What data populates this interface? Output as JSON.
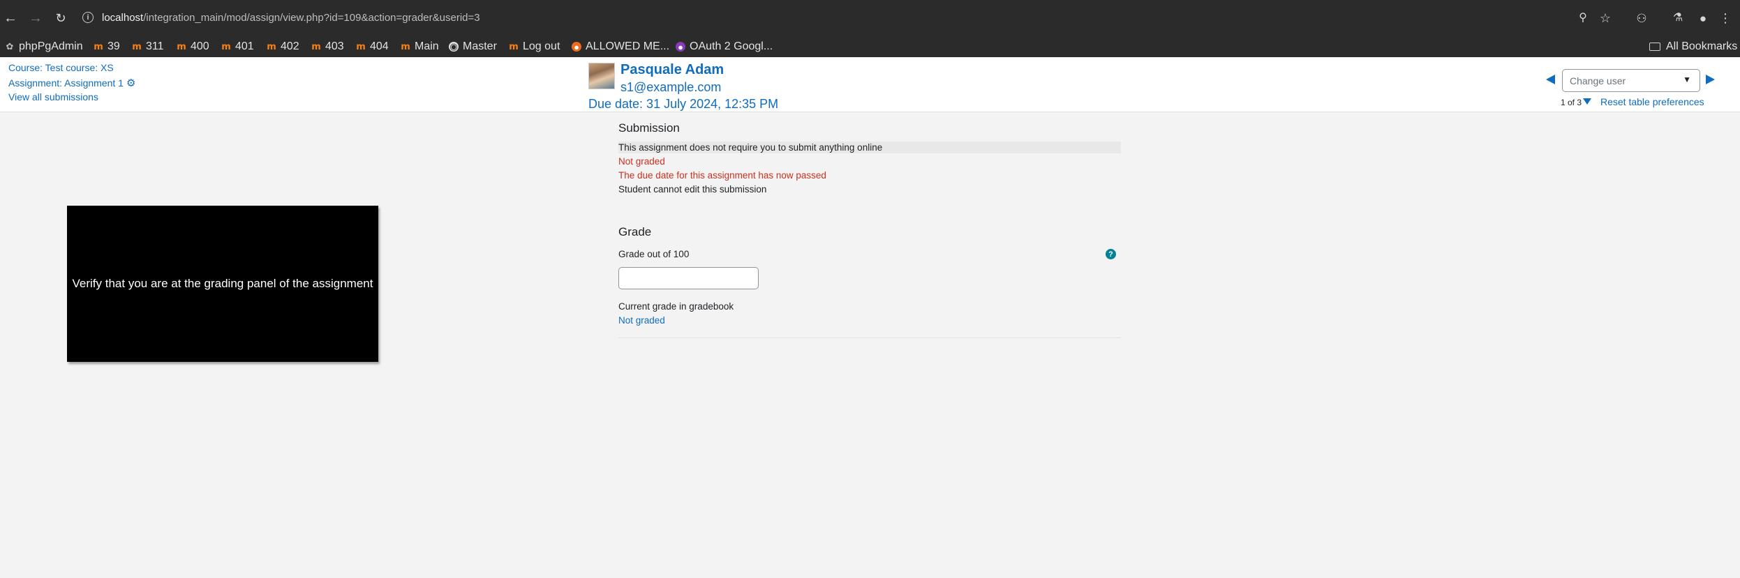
{
  "browser": {
    "url_host": "localhost",
    "url_path": "/integration_main/mod/assign/view.php?id=109&action=grader&userid=3",
    "bookmarks": [
      {
        "label": "phpPgAdmin",
        "icon": "elephant-icon"
      },
      {
        "label": "39",
        "icon": "moodle-icon"
      },
      {
        "label": "311",
        "icon": "moodle-icon"
      },
      {
        "label": "400",
        "icon": "moodle-icon"
      },
      {
        "label": "401",
        "icon": "moodle-icon"
      },
      {
        "label": "402",
        "icon": "moodle-icon"
      },
      {
        "label": "403",
        "icon": "moodle-icon"
      },
      {
        "label": "404",
        "icon": "moodle-icon"
      },
      {
        "label": "Main",
        "icon": "moodle-icon"
      },
      {
        "label": "Master",
        "icon": "globe-icon"
      },
      {
        "label": "Log out",
        "icon": "moodle-icon"
      },
      {
        "label": "ALLOWED ME...",
        "icon": "orange-circle-icon"
      },
      {
        "label": "OAuth 2 Googl...",
        "icon": "purple-circle-icon"
      }
    ],
    "all_bookmarks": "All Bookmarks"
  },
  "header": {
    "course_link": "Course: Test course: XS",
    "assignment_link": "Assignment: Assignment 1",
    "view_all": "View all submissions",
    "user_name": "Pasquale Adam",
    "user_email": "s1@example.com",
    "due_date": "Due date: 31 July 2024, 12:35 PM",
    "change_user_placeholder": "Change user",
    "count": "1 of 3",
    "reset_prefs": "Reset table preferences"
  },
  "overlay": {
    "text": "Verify that you are at the grading panel of the assignment"
  },
  "submission": {
    "title": "Submission",
    "online_text": "This assignment does not require you to submit anything online",
    "status_grade": "Not graded",
    "due_passed": "The due date for this assignment has now passed",
    "edit_status": "Student cannot edit this submission"
  },
  "grade": {
    "title": "Grade",
    "grade_out_of": "Grade out of 100",
    "current_label": "Current grade in gradebook",
    "current_value": "Not graded"
  },
  "colors": {
    "link": "#0f6cbf",
    "error": "#ca3120",
    "help": "#008196"
  }
}
